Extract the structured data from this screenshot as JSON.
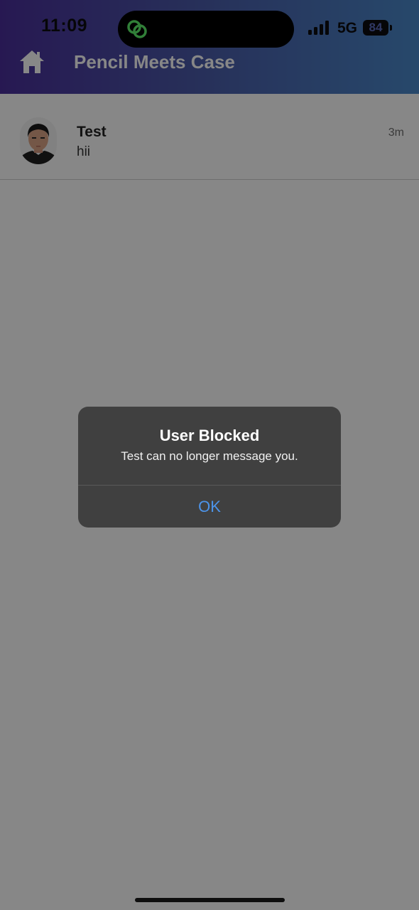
{
  "status_bar": {
    "time": "11:09",
    "network": "5G",
    "battery_level": "84",
    "island_icon": "linked-rings-icon",
    "signal_icon": "cellular-signal-icon"
  },
  "header": {
    "title": "Pencil Meets Case",
    "home_icon": "home-icon",
    "gradient_colors": [
      "#4a2f9c",
      "#4a89ca"
    ]
  },
  "conversations": [
    {
      "name": "Test",
      "last_message": "hii",
      "time": "3m"
    }
  ],
  "alert": {
    "title": "User Blocked",
    "message": "Test can no longer message you.",
    "ok_label": "OK",
    "button_color": "#4c94ea"
  }
}
